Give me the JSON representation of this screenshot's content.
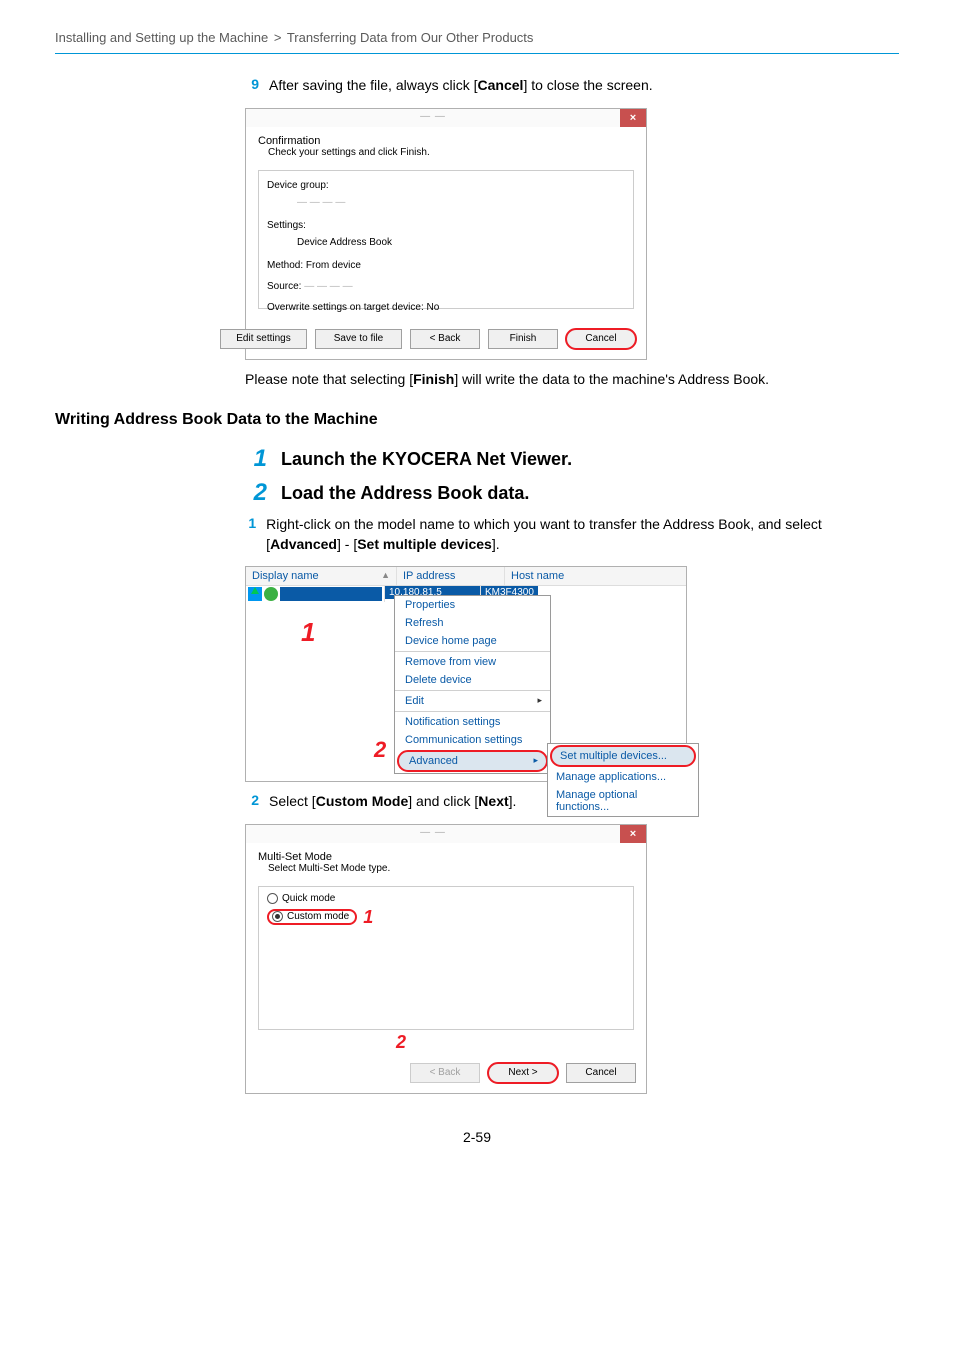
{
  "header": {
    "crumb1": "Installing and Setting up the Machine",
    "sep": ">",
    "crumb2": "Transferring Data from Our Other Products"
  },
  "step9": {
    "num": "9",
    "text_before": "After saving the file, always click [",
    "bold": "Cancel",
    "text_after": "] to close the screen."
  },
  "fig1": {
    "title_blur": "— —",
    "close": "×",
    "main_label": "Confirmation",
    "sub_label": "Check your settings and click Finish.",
    "device_group": "Device group:",
    "settings": "Settings:",
    "settings_value": "Device Address Book",
    "method": "Method: From device",
    "source": "Source:",
    "overwrite": "Overwrite settings on target device: No",
    "btn_edit": "Edit settings",
    "btn_save": "Save to file",
    "btn_back": "< Back",
    "btn_finish": "Finish",
    "btn_cancel": "Cancel"
  },
  "note": {
    "before": "Please note that selecting [",
    "bold": "Finish",
    "after": "] will write the data to the machine's Address Book."
  },
  "h2": "Writing Address Book Data to the Machine",
  "major1": {
    "num": "1",
    "text": "Launch the KYOCERA Net Viewer."
  },
  "major2": {
    "num": "2",
    "text": "Load the Address Book data."
  },
  "sub1": {
    "num": "1",
    "t1": "Right-click on the model name to which you want to transfer the Address Book, and select [",
    "b1": "Advanced",
    "t2": "] - [",
    "b2": "Set multiple devices",
    "t3": "]."
  },
  "fig2": {
    "col1": "Display name",
    "col2": "IP address",
    "col3": "Host name",
    "ip_sel": "10.180.81.5",
    "host_sel": "KM3F4300",
    "menu": {
      "properties": "Properties",
      "refresh": "Refresh",
      "device_home": "Device home page",
      "remove": "Remove from view",
      "delete": "Delete device",
      "edit": "Edit",
      "notif": "Notification settings",
      "comm": "Communication settings",
      "advanced": "Advanced"
    },
    "submenu": {
      "set_multi": "Set multiple devices...",
      "manage_app": "Manage applications...",
      "manage_opt": "Manage optional functions..."
    },
    "callout1": "1",
    "callout2": "2"
  },
  "sub2": {
    "num": "2",
    "t1": "Select [",
    "b1": "Custom Mode",
    "t2": "] and click [",
    "b2": "Next",
    "t3": "]."
  },
  "fig3": {
    "title_blur": "— —",
    "close": "×",
    "main_label": "Multi-Set Mode",
    "sub_label": "Select Multi-Set Mode type.",
    "quick": "Quick mode",
    "custom": "Custom mode",
    "btn_back": "< Back",
    "btn_next": "Next >",
    "btn_cancel": "Cancel",
    "callout1": "1",
    "callout2": "2"
  },
  "page_num": "2-59"
}
